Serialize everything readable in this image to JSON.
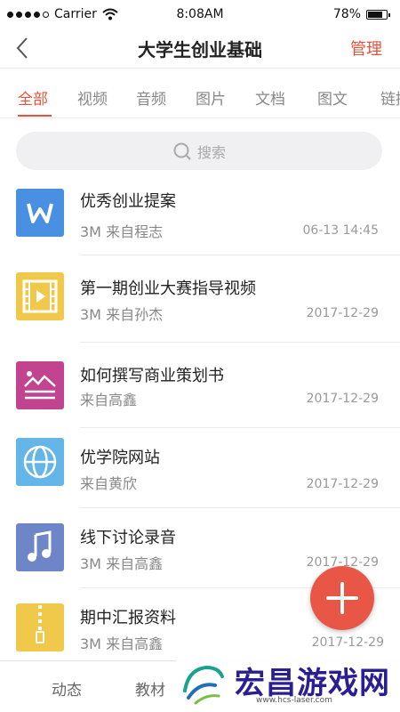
{
  "status_bar": {
    "carrier": "Carrier",
    "time": "8:08AM",
    "battery_percent": "78%",
    "battery_level": 0.78
  },
  "nav": {
    "title": "大学生创业基础",
    "manage_label": "管理"
  },
  "tabs": {
    "active_index": 0,
    "items": [
      {
        "label": "全部"
      },
      {
        "label": "视频"
      },
      {
        "label": "音频"
      },
      {
        "label": "图片"
      },
      {
        "label": "文档"
      },
      {
        "label": "图文"
      },
      {
        "label": "链接"
      }
    ]
  },
  "search": {
    "placeholder": "搜索"
  },
  "files": [
    {
      "name": "优秀创业提案",
      "meta": "3M 来自程志",
      "date": "06-13 14:45",
      "icon": "word-doc-icon",
      "color": "#4a90e2"
    },
    {
      "name": "第一期创业大赛指导视频",
      "meta": "3M 来自孙杰",
      "date": "2017-12-29",
      "icon": "video-file-icon",
      "color": "#f0c94a"
    },
    {
      "name": "如何撰写商业策划书",
      "meta": "来自高鑫",
      "date": "2017-12-29",
      "icon": "image-text-icon",
      "color": "#c2438f"
    },
    {
      "name": "优学院网站",
      "meta": "来自黄欣",
      "date": "2017-12-29",
      "icon": "web-link-icon",
      "color": "#64b5e8"
    },
    {
      "name": "线下讨论录音",
      "meta": "3M 来自高鑫",
      "date": "2017-12-29",
      "icon": "audio-file-icon",
      "color": "#6e85c7"
    },
    {
      "name": "期中汇报资料",
      "meta": "3M 来自高鑫",
      "date": "2017-12-29",
      "icon": "zip-file-icon",
      "color": "#f0c94a"
    }
  ],
  "bottom_nav": {
    "items": [
      {
        "label": "动态"
      },
      {
        "label": "教材"
      }
    ]
  },
  "watermark": {
    "title": "宏昌游戏网",
    "url": "www.hcs-laser.com"
  }
}
